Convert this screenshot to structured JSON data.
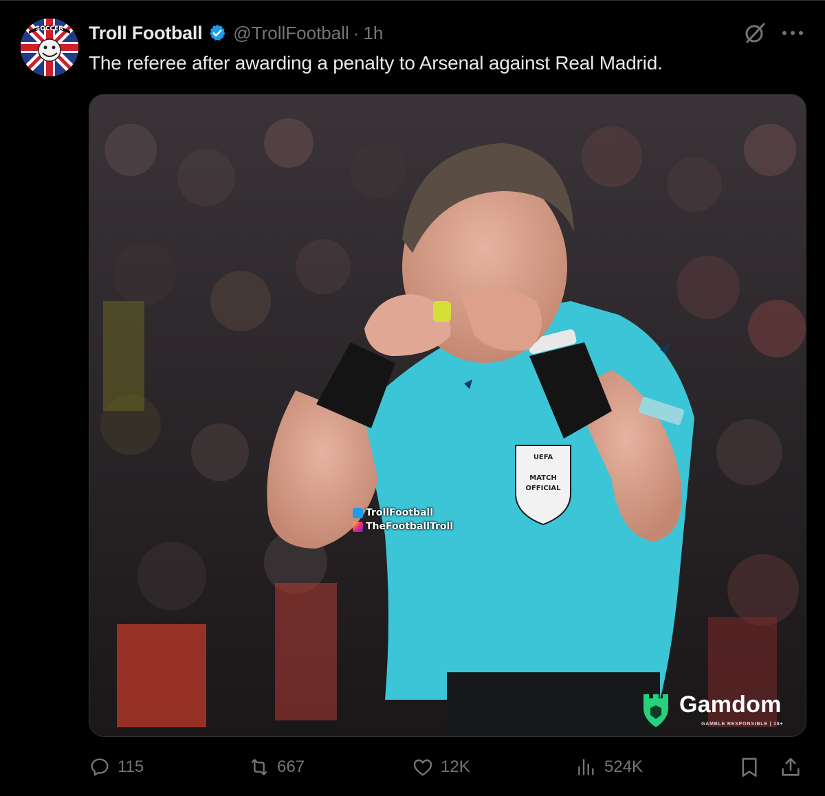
{
  "post": {
    "display_name": "Troll Football",
    "handle": "@TrollFootball",
    "separator": "·",
    "time": "1h",
    "text": "The referee after awarding a penalty to Arsenal against Real Madrid.",
    "verified": true
  },
  "avatar": {
    "badge_text": "SOCCER"
  },
  "media": {
    "watermark_twitter": "TrollFootball",
    "watermark_instagram": "TheFootballTroll",
    "badge_top": "UEFA",
    "badge_line1": "MATCH",
    "badge_line2": "OFFICIAL",
    "sponsor_name": "Gamdom",
    "sponsor_sub": "GAMBLE RESPONSIBLE | 18+"
  },
  "actions": {
    "replies": "115",
    "reposts": "667",
    "likes": "12K",
    "views": "524K"
  },
  "colors": {
    "background": "#000000",
    "text_primary": "#e7e9ea",
    "text_secondary": "#71767b",
    "verified_blue": "#1d9bf0",
    "referee_shirt": "#3cc5d6",
    "sponsor_green": "#26d07c"
  },
  "icons": [
    "verified-badge-icon",
    "grok-icon",
    "more-icon",
    "reply-icon",
    "retweet-icon",
    "like-icon",
    "views-icon",
    "bookmark-icon",
    "share-icon"
  ]
}
